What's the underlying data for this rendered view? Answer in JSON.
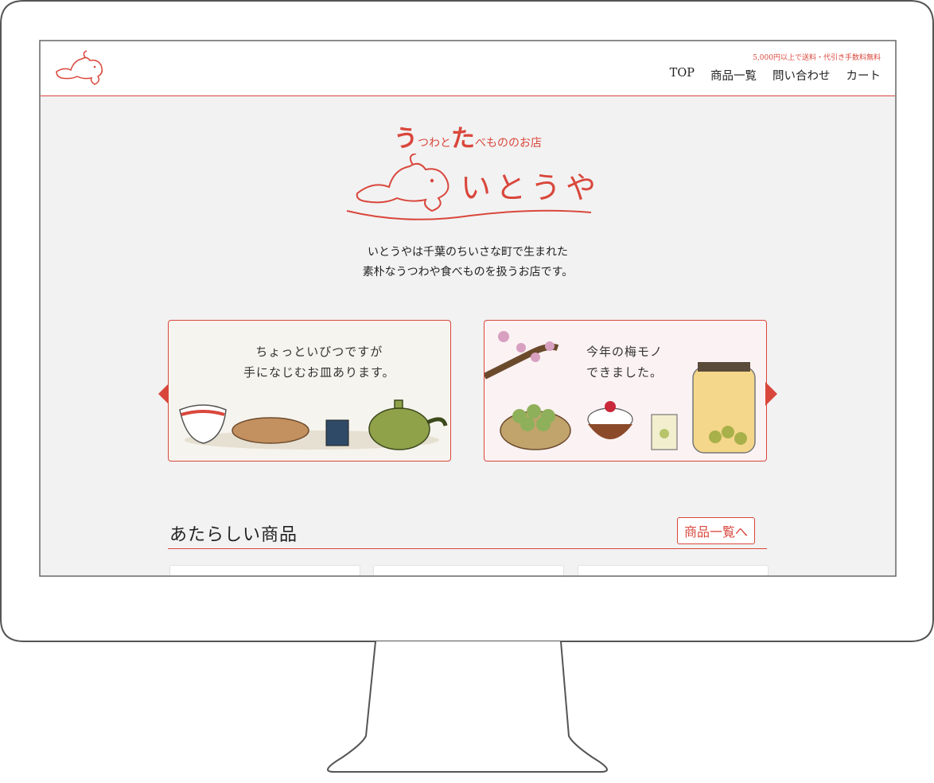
{
  "header": {
    "shipping_notice": "5,000円以上で送料・代引き手数料無料",
    "nav": [
      "TOP",
      "商品一覧",
      "問い合わせ",
      "カート"
    ]
  },
  "hero": {
    "tagline_u": "う",
    "tagline_1": "つわと",
    "tagline_ta": "た",
    "tagline_2": "べもののお店",
    "brand_name": "いとうや",
    "intro_line1": "いとうやは千葉のちいさな町で生まれた",
    "intro_line2": "素朴なうつわや食べものを扱うお店です。"
  },
  "banners": [
    {
      "line1": "ちょっといびつですが",
      "line2": "手になじむお皿あります。"
    },
    {
      "line1": "今年の梅モノ",
      "line2": "できました。"
    }
  ],
  "new_items": {
    "title": "あたらしい商品",
    "link_label": "商品一覧へ"
  },
  "colors": {
    "accent": "#d9473c",
    "background": "#f2f2f2"
  }
}
